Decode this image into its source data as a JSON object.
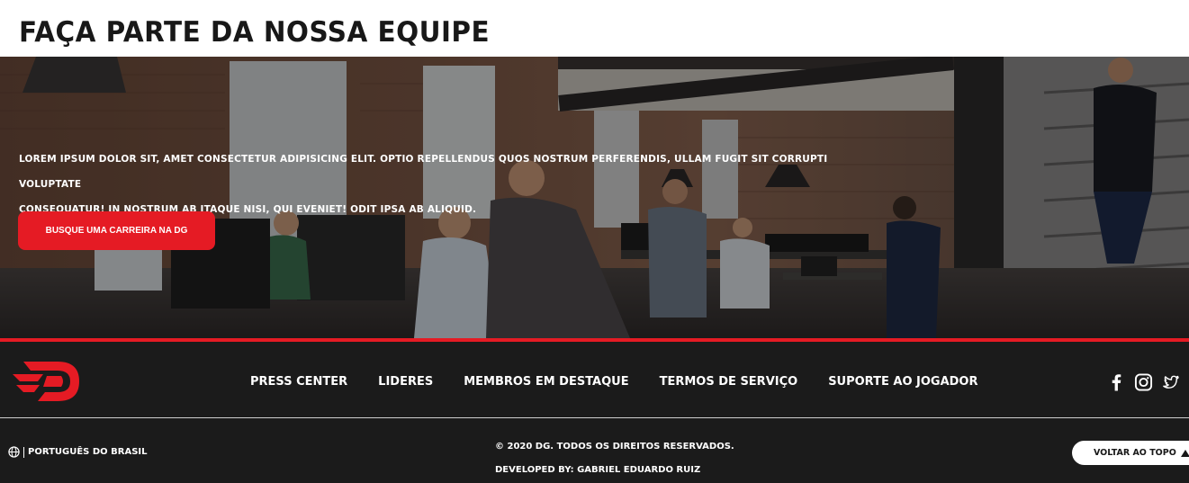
{
  "page": {
    "title": "FAÇA PARTE DA NOSSA EQUIPE"
  },
  "hero": {
    "text_line1": "LOREM IPSUM DOLOR SIT, AMET CONSECTETUR ADIPISICING ELIT. OPTIO REPELLENDUS QUOS NOSTRUM PERFERENDIS, ULLAM FUGIT SIT CORRUPTI VOLUPTATE",
    "text_line2": "CONSEQUATUR! IN NOSTRUM AB ITAQUE NISI, QUI EVENIET! ODIT IPSA AB ALIQUID.",
    "cta_label": "BUSQUE UMA CARREIRA NA DG"
  },
  "footer": {
    "nav": [
      {
        "label": "PRESS CENTER"
      },
      {
        "label": "LIDERES"
      },
      {
        "label": "MEMBROS EM DESTAQUE"
      },
      {
        "label": "TERMOS DE SERVIÇO"
      },
      {
        "label": "SUPORTE AO JOGADOR"
      }
    ],
    "socials": [
      "facebook-icon",
      "instagram-icon",
      "twitter-icon"
    ],
    "language": "PORTUGUÊS DO BRASIL",
    "copyright": "© 2020 DG. TODOS OS DIREITOS RESERVADOS.",
    "developer": "DEVELOPED BY: GABRIEL EDUARDO RUIZ",
    "back_to_top": "VOLTAR AO TOPO"
  },
  "colors": {
    "accent": "#e51b24",
    "footer_bg": "#1b1b1b",
    "title_text": "#181818"
  }
}
